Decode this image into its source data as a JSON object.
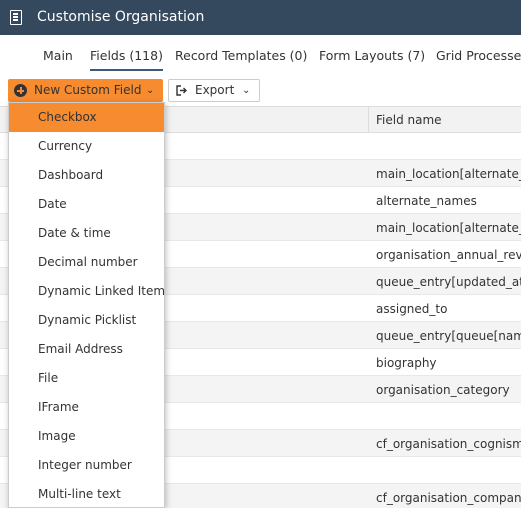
{
  "window": {
    "title": "Customise Organisation"
  },
  "tabs": [
    {
      "label": "Main"
    },
    {
      "label": "Fields (118)"
    },
    {
      "label": "Record Templates (0)"
    },
    {
      "label": "Form Layouts (7)"
    },
    {
      "label": "Grid Processes"
    }
  ],
  "active_tab": "Fields (118)",
  "toolbar": {
    "new_field_label": "New Custom Field",
    "export_label": "Export"
  },
  "grid": {
    "column_header": "Field name",
    "rows": [
      "",
      "main_location[alternate_e",
      "alternate_names",
      "main_location[alternate_te",
      "organisation_annual_reve",
      "queue_entry[updated_at]",
      "assigned_to",
      "queue_entry[queue[name",
      "biography",
      "organisation_category",
      "",
      "cf_organisation_cognism_i",
      "",
      "cf_organisation_company_"
    ]
  },
  "dropdown": {
    "selected": "Checkbox",
    "options": [
      "Checkbox",
      "Currency",
      "Dashboard",
      "Date",
      "Date & time",
      "Decimal number",
      "Dynamic Linked Item",
      "Dynamic Picklist",
      "Email Address",
      "File",
      "IFrame",
      "Image",
      "Integer number",
      "Multi-line text"
    ]
  },
  "colors": {
    "titlebar": "#34495e",
    "accent": "#f68b30",
    "header_bg": "#f2f2f2"
  },
  "icons": [
    "app-icon",
    "plus-circle-icon",
    "chevron-down-icon",
    "export-icon"
  ]
}
